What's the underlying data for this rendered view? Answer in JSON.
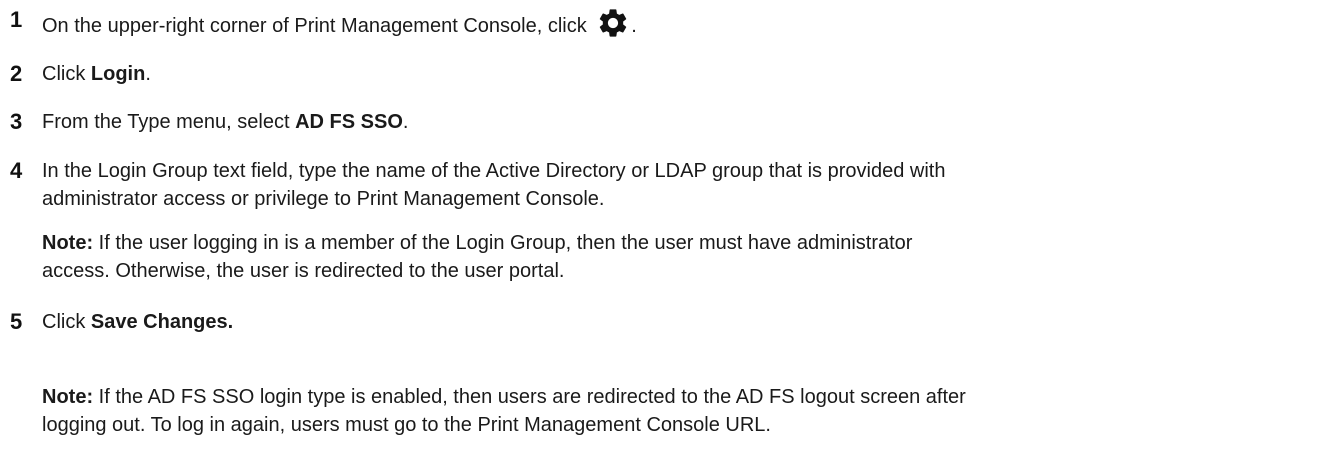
{
  "steps": [
    {
      "number": "1",
      "text_before": "On the upper-right corner of Print Management Console, click ",
      "icon": "gear-icon",
      "text_after": "."
    },
    {
      "number": "2",
      "text_before": "Click ",
      "bold": "Login",
      "text_after": "."
    },
    {
      "number": "3",
      "text_before": "From the Type menu, select ",
      "bold": "AD FS SSO",
      "text_after": "."
    },
    {
      "number": "4",
      "line1": "In the Login Group text field, type the name of the Active Directory or LDAP group that is provided with",
      "line2": "administrator access or privilege to Print Management Console.",
      "note_label": "Note:",
      "note_line1": " If the user logging in is a member of the Login Group, then the user must have administrator",
      "note_line2": "access. Otherwise, the user is redirected to the user portal."
    },
    {
      "number": "5",
      "text_before": "Click ",
      "bold": "Save Changes.",
      "note_label": "Note:",
      "note_line1": " If the AD FS SSO login type is enabled, then users are redirected to the AD FS logout screen after",
      "note_line2": "logging out. To log in again, users must go to the Print Management Console URL."
    }
  ],
  "colors": {
    "text": "#1a1a1a",
    "icon": "#111111"
  }
}
